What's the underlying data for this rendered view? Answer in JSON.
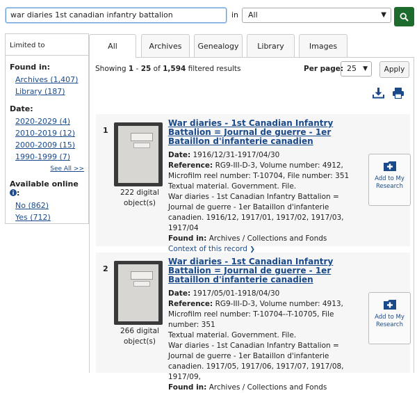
{
  "search": {
    "query": "war diaries 1st canadian infantry battalion",
    "in_label": "in",
    "scope": "All"
  },
  "sidebar": {
    "header": "Limited to",
    "found_in_title": "Found in:",
    "found_in": [
      "Archives (1,407)",
      "Library (187)"
    ],
    "date_title": "Date:",
    "dates": [
      "2020-2029 (4)",
      "2010-2019 (12)",
      "2000-2009 (15)",
      "1990-1999 (7)"
    ],
    "see_all": "See All >>",
    "online_title": "Available online",
    "online_colon": ":",
    "online": [
      "No (862)",
      "Yes (712)"
    ]
  },
  "tabs": [
    "All",
    "Archives",
    "Genealogy",
    "Library",
    "Images"
  ],
  "results_header": {
    "showing_prefix": "Showing ",
    "range_start": "1",
    "range_sep": " - ",
    "range_end": "25",
    "of": " of ",
    "total": "1,594",
    "suffix": " filtered results",
    "per_page_label": "Per page:",
    "per_page_value": "25",
    "apply": "Apply"
  },
  "results": [
    {
      "num": "1",
      "title": "War diaries - 1st Canadian Infantry Battalion = Journal de guerre - 1er Bataillon d'infanterie canadien",
      "digital": "222 digital object(s)",
      "date_label": "Date:",
      "date": "1916/12/31-1917/04/30",
      "ref_label": "Reference:",
      "reference": "RG9-III-D-3, Volume number: 4912, Microfilm reel number: T-10704, File number: 351",
      "type": "Textual material. Government. File.",
      "desc": "War diaries - 1st Canadian Infantry Battalion = Journal de guerre - 1er Bataillon d'infanterie canadien. 1916/12, 1917/01, 1917/02, 1917/03, 1917/04",
      "found_label": "Found in:",
      "found": "Archives / Collections and Fonds",
      "context": "Context of this record",
      "add": "Add to My Research"
    },
    {
      "num": "2",
      "title": "War diaries - 1st Canadian Infantry Battalion = Journal de guerre - 1er Bataillon d'infanterie canadien",
      "digital": "266 digital object(s)",
      "date_label": "Date:",
      "date": "1917/05/01-1918/04/30",
      "ref_label": "Reference:",
      "reference": "RG9-III-D-3, Volume number: 4913, Microfilm reel number: T-10704--T-10705, File number: 351",
      "type": "Textual material. Government. File.",
      "desc": "War diaries - 1st Canadian Infantry Battalion = Journal de guerre - 1er Bataillon d'infanterie canadien. 1917/05, 1917/06, 1917/07, 1917/08, 1917/09,",
      "found_label": "Found in:",
      "found": "Archives / Collections and Fonds",
      "add": "Add to My Research"
    }
  ],
  "colors": {
    "accent": "#1e6b2e",
    "link": "#1a4a8a",
    "panel": "#f6f6f6"
  },
  "icons": [
    "search-icon",
    "download-icon",
    "print-icon",
    "info-icon",
    "chevron-down-icon",
    "bookmark-plus-icon"
  ]
}
